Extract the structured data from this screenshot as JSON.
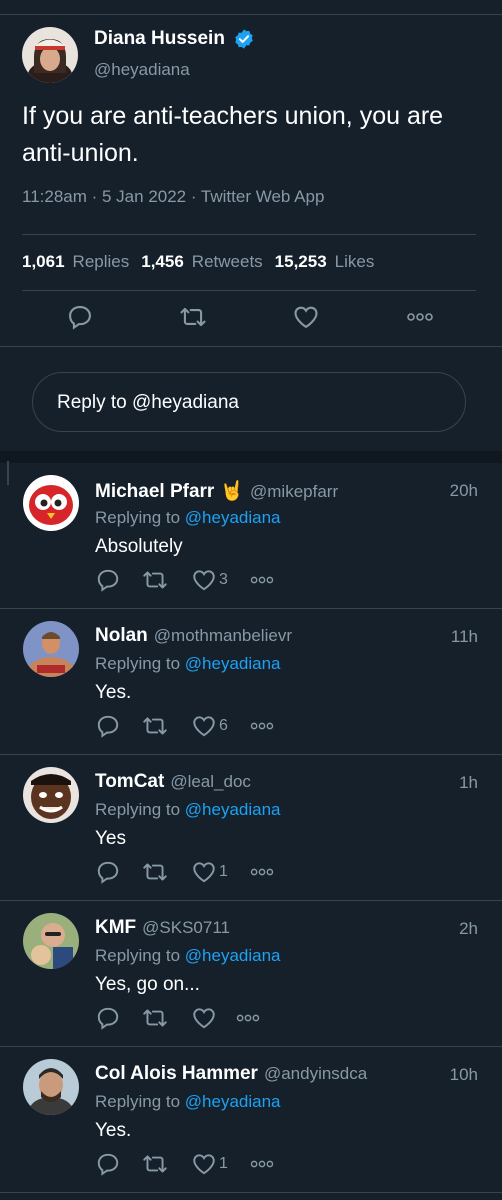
{
  "tweet": {
    "author_name": "Diana Hussein",
    "author_handle": "@heyadiana",
    "text": "If you are anti-teachers union, you are anti-union.",
    "meta": "11:28am · 5 Jan 2022 · Twitter Web App",
    "stats": {
      "replies_count": "1,061",
      "replies_label": "Replies",
      "retweets_count": "1,456",
      "retweets_label": "Retweets",
      "likes_count": "15,253",
      "likes_label": "Likes"
    }
  },
  "reply_box": {
    "placeholder": "Reply to @heyadiana"
  },
  "replying_prefix": "Replying to",
  "replies": [
    {
      "name": "Michael Pfarr",
      "emoji": "🤘",
      "handle": "@mikepfarr",
      "time": "20h",
      "replying_to": "@heyadiana",
      "text": "Absolutely",
      "likes": "3"
    },
    {
      "name": "Nolan",
      "handle": "@mothmanbelievr",
      "time": "11h",
      "replying_to": "@heyadiana",
      "text": "Yes.",
      "likes": "6"
    },
    {
      "name": "TomCat",
      "handle": "@leal_doc",
      "time": "1h",
      "replying_to": "@heyadiana",
      "text": "Yes",
      "likes": "1"
    },
    {
      "name": "KMF",
      "handle": "@SKS0711",
      "time": "2h",
      "replying_to": "@heyadiana",
      "text": "Yes, go on...",
      "likes": ""
    },
    {
      "name": "Col Alois Hammer",
      "handle": "@andyinsdca",
      "time": "10h",
      "replying_to": "@heyadiana",
      "text": "Yes.",
      "likes": "1"
    }
  ],
  "colors": {
    "background": "#15202b",
    "accent": "#1da1f2",
    "muted": "#8899a6",
    "divider": "#38444d"
  }
}
